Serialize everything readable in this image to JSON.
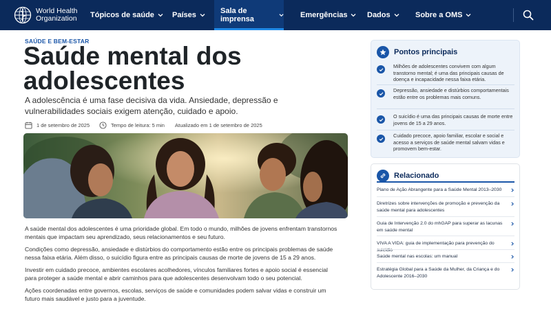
{
  "colors": {
    "nav_bg": "#0b2a5b",
    "accent": "#1a56a8",
    "active_underline": "#1e88e5",
    "card_bg": "#edf3fa"
  },
  "nav": {
    "logo_line1": "World Health",
    "logo_line2": "Organization",
    "items": [
      {
        "label": "Tópicos de saúde",
        "active": false
      },
      {
        "label": "Países",
        "active": false
      },
      {
        "label": "Sala de imprensa",
        "active": true
      },
      {
        "label": "Emergências",
        "active": false
      },
      {
        "label": "Dados",
        "active": false
      },
      {
        "label": "Sobre a OMS",
        "active": false
      }
    ],
    "search_icon": "search-icon"
  },
  "article": {
    "eyebrow": "SAÚDE E BEM-ESTAR",
    "title": "Saúde mental dos adolescentes",
    "lede": "A adolescência é uma fase decisiva da vida. Ansiedade, depressão e vulnerabilidades sociais exigem atenção, cuidado e apoio.",
    "meta": {
      "date": "1 de setembro de 2025",
      "reading_time": "Tempo de leitura: 5 min",
      "updated": "Atualizado em 1 de setembro de 2025"
    },
    "paragraphs": [
      "A saúde mental dos adolescentes é uma prioridade global. Em todo o mundo, milhões de jovens enfrentam transtornos mentais que impactam seu aprendizado, seus relacionamentos e seu futuro.",
      "Condições como depressão, ansiedade e distúrbios do comportamento estão entre os principais problemas de saúde nessa faixa etária. Além disso, o suicídio figura entre as principais causas de morte de jovens de 15 a 29 anos.",
      "Investir em cuidado precoce, ambientes escolares acolhedores, vínculos familiares fortes e apoio social é essencial para proteger a saúde mental e abrir caminhos para que adolescentes desenvolvam todo o seu potencial.",
      "Ações coordenadas entre governos, escolas, serviços de saúde e comunidades podem salvar vidas e construir um futuro mais saudável e justo para a juventude."
    ]
  },
  "sidebar": {
    "key_points": {
      "title": "Pontos principais",
      "items": [
        "Milhões de adolescentes convivem com algum transtorno mental; é uma das principais causas de doença e incapacidade nessa faixa etária.",
        "Depressão, ansiedade e distúrbios comportamentais estão entre os problemas mais comuns.",
        "O suicídio é uma das principais causas de morte entre jovens de 15 a 29 anos.",
        "Cuidado precoce, apoio familiar, escolar e social e acesso a serviços de saúde mental salvam vidas e promovem bem-estar."
      ]
    },
    "related": {
      "title": "Relacionado",
      "items": [
        "Plano de Ação Abrangente para a Saúde Mental 2013–2030",
        "Diretrizes sobre intervenções de promoção e prevenção da saúde mental para adolescentes",
        "Guia de Intervenção 2.0 do mhGAP para superar as lacunas em saúde mental",
        "VIVA A VIDA: guia de implementação para prevenção do suicídio",
        "Saúde mental nas escolas: um manual",
        "Estratégia Global para a Saúde da Mulher, da Criança e do Adolescente 2016–2030"
      ]
    }
  }
}
